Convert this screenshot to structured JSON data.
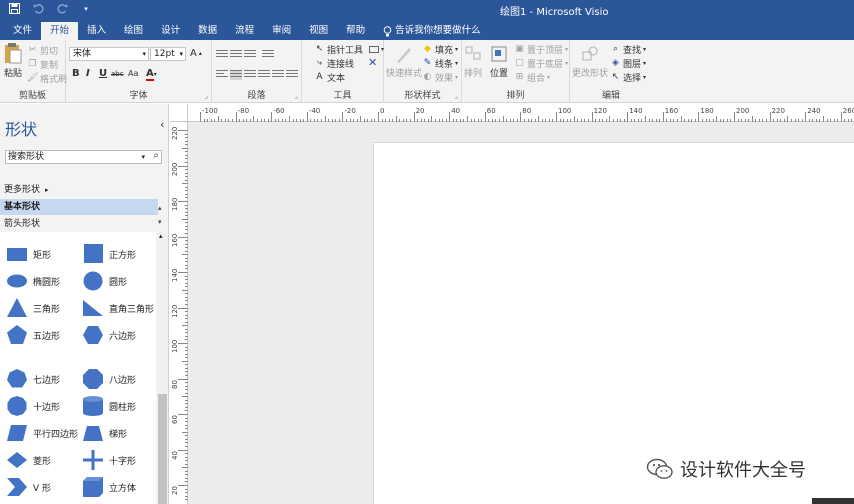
{
  "window": {
    "title": "绘图1 - Microsoft Visio"
  },
  "qat": {
    "save_icon": "save-icon",
    "undo_icon": "undo-icon",
    "redo_icon": "redo-icon",
    "more_icon": "chevron-down-icon"
  },
  "tabs": [
    {
      "label": "文件"
    },
    {
      "label": "开始"
    },
    {
      "label": "插入"
    },
    {
      "label": "绘图"
    },
    {
      "label": "设计"
    },
    {
      "label": "数据"
    },
    {
      "label": "流程"
    },
    {
      "label": "审阅"
    },
    {
      "label": "视图"
    },
    {
      "label": "帮助"
    }
  ],
  "tellme": {
    "label": "告诉我你想要做什么"
  },
  "ribbon": {
    "clipboard": {
      "label": "剪贴板",
      "paste": "粘贴",
      "cut": "剪切",
      "copy": "复制",
      "format_painter": "格式刷"
    },
    "font": {
      "label": "字体",
      "font_name": "宋体",
      "font_size": "12pt",
      "bold": "B",
      "italic": "I",
      "underline": "U",
      "strike": "abc",
      "case": "Aa",
      "color": "A"
    },
    "paragraph": {
      "label": "段落"
    },
    "tools": {
      "label": "工具",
      "pointer": "指针工具",
      "connector": "连接线",
      "text": "文本"
    },
    "shape_styles": {
      "label": "形状样式",
      "quick_styles": "快速样式",
      "fill": "填充",
      "line": "线条",
      "effects": "效果"
    },
    "arrange": {
      "label": "排列",
      "align": "排列",
      "position": "位置",
      "bring_front": "置于顶层",
      "send_back": "置于底层",
      "group": "组合"
    },
    "editing": {
      "label": "编辑",
      "change_shape": "更改形状",
      "find": "查找",
      "layers": "图层",
      "select": "选择"
    }
  },
  "shapes_panel": {
    "title": "形状",
    "search_placeholder": "搜索形状",
    "more_shapes": "更多形状",
    "stencils": [
      "基本形状",
      "箭头形状"
    ],
    "shapes": [
      {
        "label": "矩形",
        "icon": "rectangle-icon"
      },
      {
        "label": "正方形",
        "icon": "square-icon"
      },
      {
        "label": "椭圆形",
        "icon": "ellipse-icon"
      },
      {
        "label": "圆形",
        "icon": "circle-icon"
      },
      {
        "label": "三角形",
        "icon": "triangle-icon"
      },
      {
        "label": "直角三角形",
        "icon": "right-triangle-icon"
      },
      {
        "label": "五边形",
        "icon": "pentagon-icon"
      },
      {
        "label": "六边形",
        "icon": "hexagon-icon"
      },
      {
        "label": "七边形",
        "icon": "heptagon-icon"
      },
      {
        "label": "八边形",
        "icon": "octagon-icon"
      },
      {
        "label": "十边形",
        "icon": "decagon-icon"
      },
      {
        "label": "圆柱形",
        "icon": "cylinder-icon"
      },
      {
        "label": "平行四边形",
        "icon": "parallelogram-icon"
      },
      {
        "label": "梯形",
        "icon": "trapezoid-icon"
      },
      {
        "label": "菱形",
        "icon": "diamond-icon"
      },
      {
        "label": "十字形",
        "icon": "cross-icon"
      },
      {
        "label": "V 形",
        "icon": "chevron-icon"
      },
      {
        "label": "立方体",
        "icon": "cube-icon"
      }
    ]
  },
  "ruler": {
    "top_labels": [
      "-100",
      "-80",
      "-60",
      "-40",
      "-20",
      "0",
      "20",
      "40",
      "60",
      "80",
      "100",
      "120",
      "140",
      "160",
      "180",
      "200",
      "220",
      "240",
      "260"
    ],
    "left_labels": [
      "220",
      "200",
      "180",
      "160",
      "140",
      "120",
      "100",
      "80",
      "60",
      "40",
      "20"
    ]
  },
  "watermark": {
    "text": "设计软件大全号"
  },
  "colors": {
    "accent": "#2b579a",
    "shape_fill": "#4472c4",
    "selected_stencil": "#c5d8f0"
  }
}
